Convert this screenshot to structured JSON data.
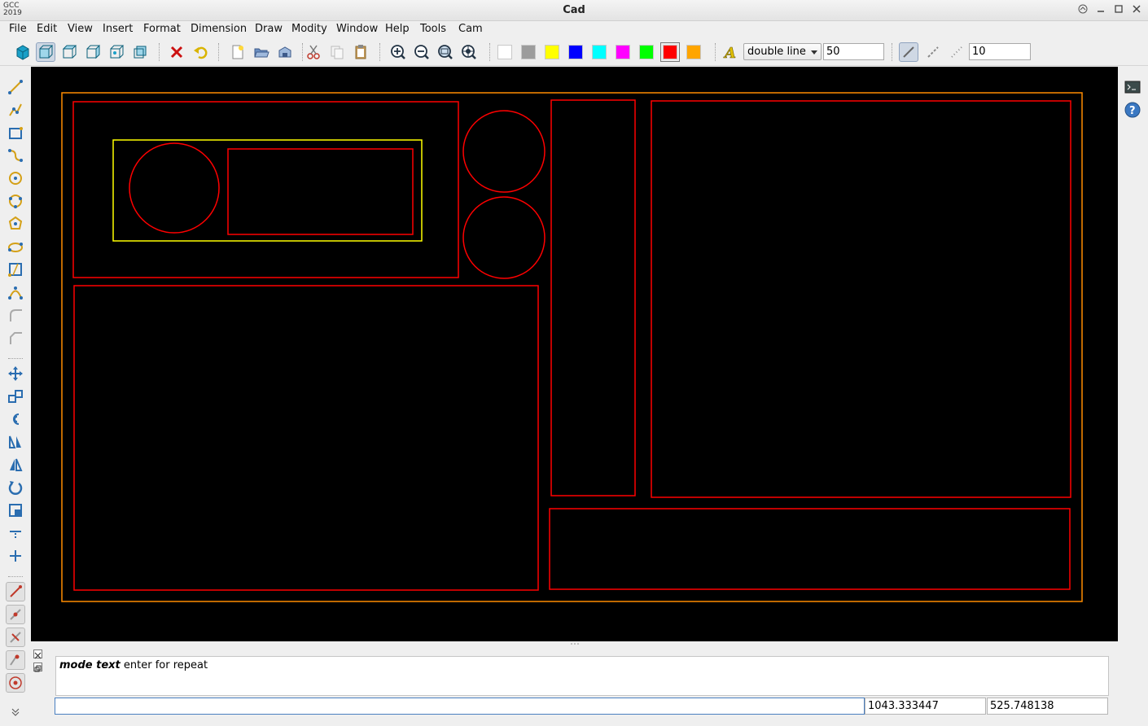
{
  "window": {
    "logo_line1": "GCC",
    "logo_line2": "2019",
    "title": "Cad"
  },
  "menu": [
    "File",
    "Edit",
    "View",
    "Insert",
    "Format",
    "Dimension",
    "Draw",
    "Modity",
    "Window",
    "Help",
    "Tools",
    "Cam"
  ],
  "toolbar": {
    "linetype": "double line",
    "line_width": "50",
    "spacing": "10",
    "colors": [
      "#ffffff",
      "#9c9c9c",
      "#ffff00",
      "#0000ff",
      "#00ffff",
      "#ff00ff",
      "#00ff00",
      "#ff0000",
      "#ffa500"
    ],
    "selected_color": "#ff0000"
  },
  "command": {
    "mode_label": "mode text",
    "hint": "enter for repeat",
    "input_value": "",
    "coord_x": "1043.333447",
    "coord_y": "525.748138"
  },
  "drawing": {
    "accent_colors": {
      "outer": "#ff8c00",
      "primary": "#ff0000",
      "selection": "#ffff00"
    }
  }
}
